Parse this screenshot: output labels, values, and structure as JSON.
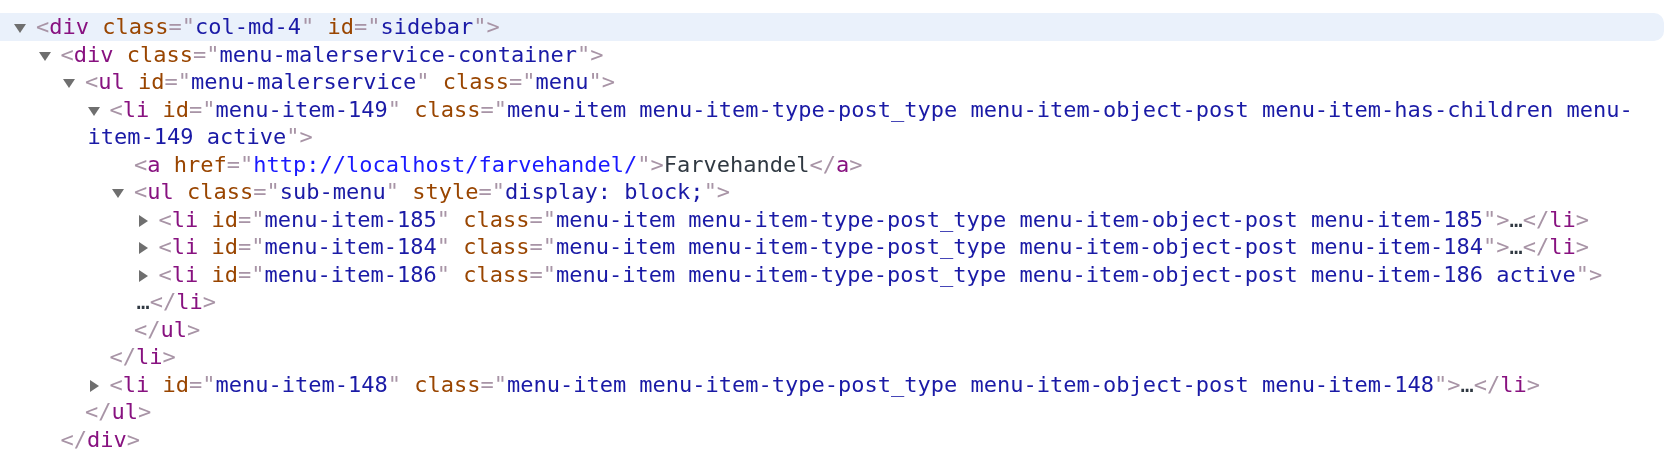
{
  "nodes": [
    {
      "selected": true,
      "expanded": true,
      "open": [
        {
          "kind": "punct",
          "text": "<"
        },
        {
          "kind": "tag",
          "text": "div"
        },
        {
          "kind": "attr",
          "text": " class"
        },
        {
          "kind": "punct",
          "text": "=\""
        },
        {
          "kind": "value",
          "text": "col-md-4"
        },
        {
          "kind": "punct",
          "text": "\""
        },
        {
          "kind": "attr",
          "text": " id"
        },
        {
          "kind": "punct",
          "text": "=\""
        },
        {
          "kind": "value",
          "text": "sidebar"
        },
        {
          "kind": "punct",
          "text": "\">"
        }
      ],
      "children": [
        {
          "selected": false,
          "expanded": true,
          "open": [
            {
              "kind": "punct",
              "text": "<"
            },
            {
              "kind": "tag",
              "text": "div"
            },
            {
              "kind": "attr",
              "text": " class"
            },
            {
              "kind": "punct",
              "text": "=\""
            },
            {
              "kind": "value",
              "text": "menu-malerservice-container"
            },
            {
              "kind": "punct",
              "text": "\">"
            }
          ],
          "children": [
            {
              "selected": false,
              "expanded": true,
              "open": [
                {
                  "kind": "punct",
                  "text": "<"
                },
                {
                  "kind": "tag",
                  "text": "ul"
                },
                {
                  "kind": "attr",
                  "text": " id"
                },
                {
                  "kind": "punct",
                  "text": "=\""
                },
                {
                  "kind": "value",
                  "text": "menu-malerservice"
                },
                {
                  "kind": "punct",
                  "text": "\""
                },
                {
                  "kind": "attr",
                  "text": " class"
                },
                {
                  "kind": "punct",
                  "text": "=\""
                },
                {
                  "kind": "value",
                  "text": "menu"
                },
                {
                  "kind": "punct",
                  "text": "\">"
                }
              ],
              "children": [
                {
                  "selected": false,
                  "expanded": true,
                  "open": [
                    {
                      "kind": "punct",
                      "text": "<"
                    },
                    {
                      "kind": "tag",
                      "text": "li"
                    },
                    {
                      "kind": "attr",
                      "text": " id"
                    },
                    {
                      "kind": "punct",
                      "text": "=\""
                    },
                    {
                      "kind": "value",
                      "text": "menu-item-149"
                    },
                    {
                      "kind": "punct",
                      "text": "\""
                    },
                    {
                      "kind": "attr",
                      "text": " class"
                    },
                    {
                      "kind": "punct",
                      "text": "=\""
                    },
                    {
                      "kind": "value",
                      "text": "menu-item menu-item-type-post_type menu-item-object-post menu-item-has-children menu-"
                    },
                    {
                      "kind": "wrap"
                    },
                    {
                      "kind": "value",
                      "text": "item-149 active"
                    },
                    {
                      "kind": "punct",
                      "text": "\">"
                    }
                  ],
                  "children": [
                    {
                      "selected": false,
                      "open": [
                        {
                          "kind": "punct",
                          "text": "<"
                        },
                        {
                          "kind": "tag",
                          "text": "a"
                        },
                        {
                          "kind": "attr",
                          "text": " href"
                        },
                        {
                          "kind": "punct",
                          "text": "=\""
                        },
                        {
                          "kind": "link",
                          "text": "http://localhost/farvehandel/"
                        },
                        {
                          "kind": "punct",
                          "text": "\">"
                        },
                        {
                          "kind": "text",
                          "text": "Farvehandel"
                        },
                        {
                          "kind": "punct",
                          "text": "</"
                        },
                        {
                          "kind": "tag",
                          "text": "a"
                        },
                        {
                          "kind": "punct",
                          "text": ">"
                        }
                      ]
                    },
                    {
                      "selected": false,
                      "expanded": true,
                      "open": [
                        {
                          "kind": "punct",
                          "text": "<"
                        },
                        {
                          "kind": "tag",
                          "text": "ul"
                        },
                        {
                          "kind": "attr",
                          "text": " class"
                        },
                        {
                          "kind": "punct",
                          "text": "=\""
                        },
                        {
                          "kind": "value",
                          "text": "sub-menu"
                        },
                        {
                          "kind": "punct",
                          "text": "\""
                        },
                        {
                          "kind": "attr",
                          "text": " style"
                        },
                        {
                          "kind": "punct",
                          "text": "=\""
                        },
                        {
                          "kind": "value",
                          "text": "display: block;"
                        },
                        {
                          "kind": "punct",
                          "text": "\">"
                        }
                      ],
                      "children": [
                        {
                          "selected": false,
                          "expanded": false,
                          "open": [
                            {
                              "kind": "punct",
                              "text": "<"
                            },
                            {
                              "kind": "tag",
                              "text": "li"
                            },
                            {
                              "kind": "attr",
                              "text": " id"
                            },
                            {
                              "kind": "punct",
                              "text": "=\""
                            },
                            {
                              "kind": "value",
                              "text": "menu-item-185"
                            },
                            {
                              "kind": "punct",
                              "text": "\""
                            },
                            {
                              "kind": "attr",
                              "text": " class"
                            },
                            {
                              "kind": "punct",
                              "text": "=\""
                            },
                            {
                              "kind": "value",
                              "text": "menu-item menu-item-type-post_type menu-item-object-post menu-item-185"
                            },
                            {
                              "kind": "punct",
                              "text": "\">"
                            },
                            {
                              "kind": "text",
                              "text": "…"
                            },
                            {
                              "kind": "punct",
                              "text": "</"
                            },
                            {
                              "kind": "tag",
                              "text": "li"
                            },
                            {
                              "kind": "punct",
                              "text": ">"
                            }
                          ]
                        },
                        {
                          "selected": false,
                          "expanded": false,
                          "open": [
                            {
                              "kind": "punct",
                              "text": "<"
                            },
                            {
                              "kind": "tag",
                              "text": "li"
                            },
                            {
                              "kind": "attr",
                              "text": " id"
                            },
                            {
                              "kind": "punct",
                              "text": "=\""
                            },
                            {
                              "kind": "value",
                              "text": "menu-item-184"
                            },
                            {
                              "kind": "punct",
                              "text": "\""
                            },
                            {
                              "kind": "attr",
                              "text": " class"
                            },
                            {
                              "kind": "punct",
                              "text": "=\""
                            },
                            {
                              "kind": "value",
                              "text": "menu-item menu-item-type-post_type menu-item-object-post menu-item-184"
                            },
                            {
                              "kind": "punct",
                              "text": "\">"
                            },
                            {
                              "kind": "text",
                              "text": "…"
                            },
                            {
                              "kind": "punct",
                              "text": "</"
                            },
                            {
                              "kind": "tag",
                              "text": "li"
                            },
                            {
                              "kind": "punct",
                              "text": ">"
                            }
                          ]
                        },
                        {
                          "selected": false,
                          "expanded": false,
                          "open": [
                            {
                              "kind": "punct",
                              "text": "<"
                            },
                            {
                              "kind": "tag",
                              "text": "li"
                            },
                            {
                              "kind": "attr",
                              "text": " id"
                            },
                            {
                              "kind": "punct",
                              "text": "=\""
                            },
                            {
                              "kind": "value",
                              "text": "menu-item-186"
                            },
                            {
                              "kind": "punct",
                              "text": "\""
                            },
                            {
                              "kind": "attr",
                              "text": " class"
                            },
                            {
                              "kind": "punct",
                              "text": "=\""
                            },
                            {
                              "kind": "value",
                              "text": "menu-item menu-item-type-post_type menu-item-object-post menu-item-186 active"
                            },
                            {
                              "kind": "punct",
                              "text": "\">"
                            },
                            {
                              "kind": "wrap"
                            },
                            {
                              "kind": "text",
                              "text": "…"
                            },
                            {
                              "kind": "punct",
                              "text": "</"
                            },
                            {
                              "kind": "tag",
                              "text": "li"
                            },
                            {
                              "kind": "punct",
                              "text": ">"
                            }
                          ]
                        }
                      ],
                      "close": [
                        {
                          "kind": "punct",
                          "text": "</"
                        },
                        {
                          "kind": "tag",
                          "text": "ul"
                        },
                        {
                          "kind": "punct",
                          "text": ">"
                        }
                      ]
                    }
                  ],
                  "close": [
                    {
                      "kind": "punct",
                      "text": "</"
                    },
                    {
                      "kind": "tag",
                      "text": "li"
                    },
                    {
                      "kind": "punct",
                      "text": ">"
                    }
                  ]
                },
                {
                  "selected": false,
                  "expanded": false,
                  "open": [
                    {
                      "kind": "punct",
                      "text": "<"
                    },
                    {
                      "kind": "tag",
                      "text": "li"
                    },
                    {
                      "kind": "attr",
                      "text": " id"
                    },
                    {
                      "kind": "punct",
                      "text": "=\""
                    },
                    {
                      "kind": "value",
                      "text": "menu-item-148"
                    },
                    {
                      "kind": "punct",
                      "text": "\""
                    },
                    {
                      "kind": "attr",
                      "text": " class"
                    },
                    {
                      "kind": "punct",
                      "text": "=\""
                    },
                    {
                      "kind": "value",
                      "text": "menu-item menu-item-type-post_type menu-item-object-post menu-item-148"
                    },
                    {
                      "kind": "punct",
                      "text": "\">"
                    },
                    {
                      "kind": "text",
                      "text": "…"
                    },
                    {
                      "kind": "punct",
                      "text": "</"
                    },
                    {
                      "kind": "tag",
                      "text": "li"
                    },
                    {
                      "kind": "punct",
                      "text": ">"
                    }
                  ]
                }
              ],
              "close": [
                {
                  "kind": "punct",
                  "text": "</"
                },
                {
                  "kind": "tag",
                  "text": "ul"
                },
                {
                  "kind": "punct",
                  "text": ">"
                }
              ]
            }
          ],
          "close": [
            {
              "kind": "punct",
              "text": "</"
            },
            {
              "kind": "tag",
              "text": "div"
            },
            {
              "kind": "punct",
              "text": ">"
            }
          ]
        }
      ]
    }
  ]
}
